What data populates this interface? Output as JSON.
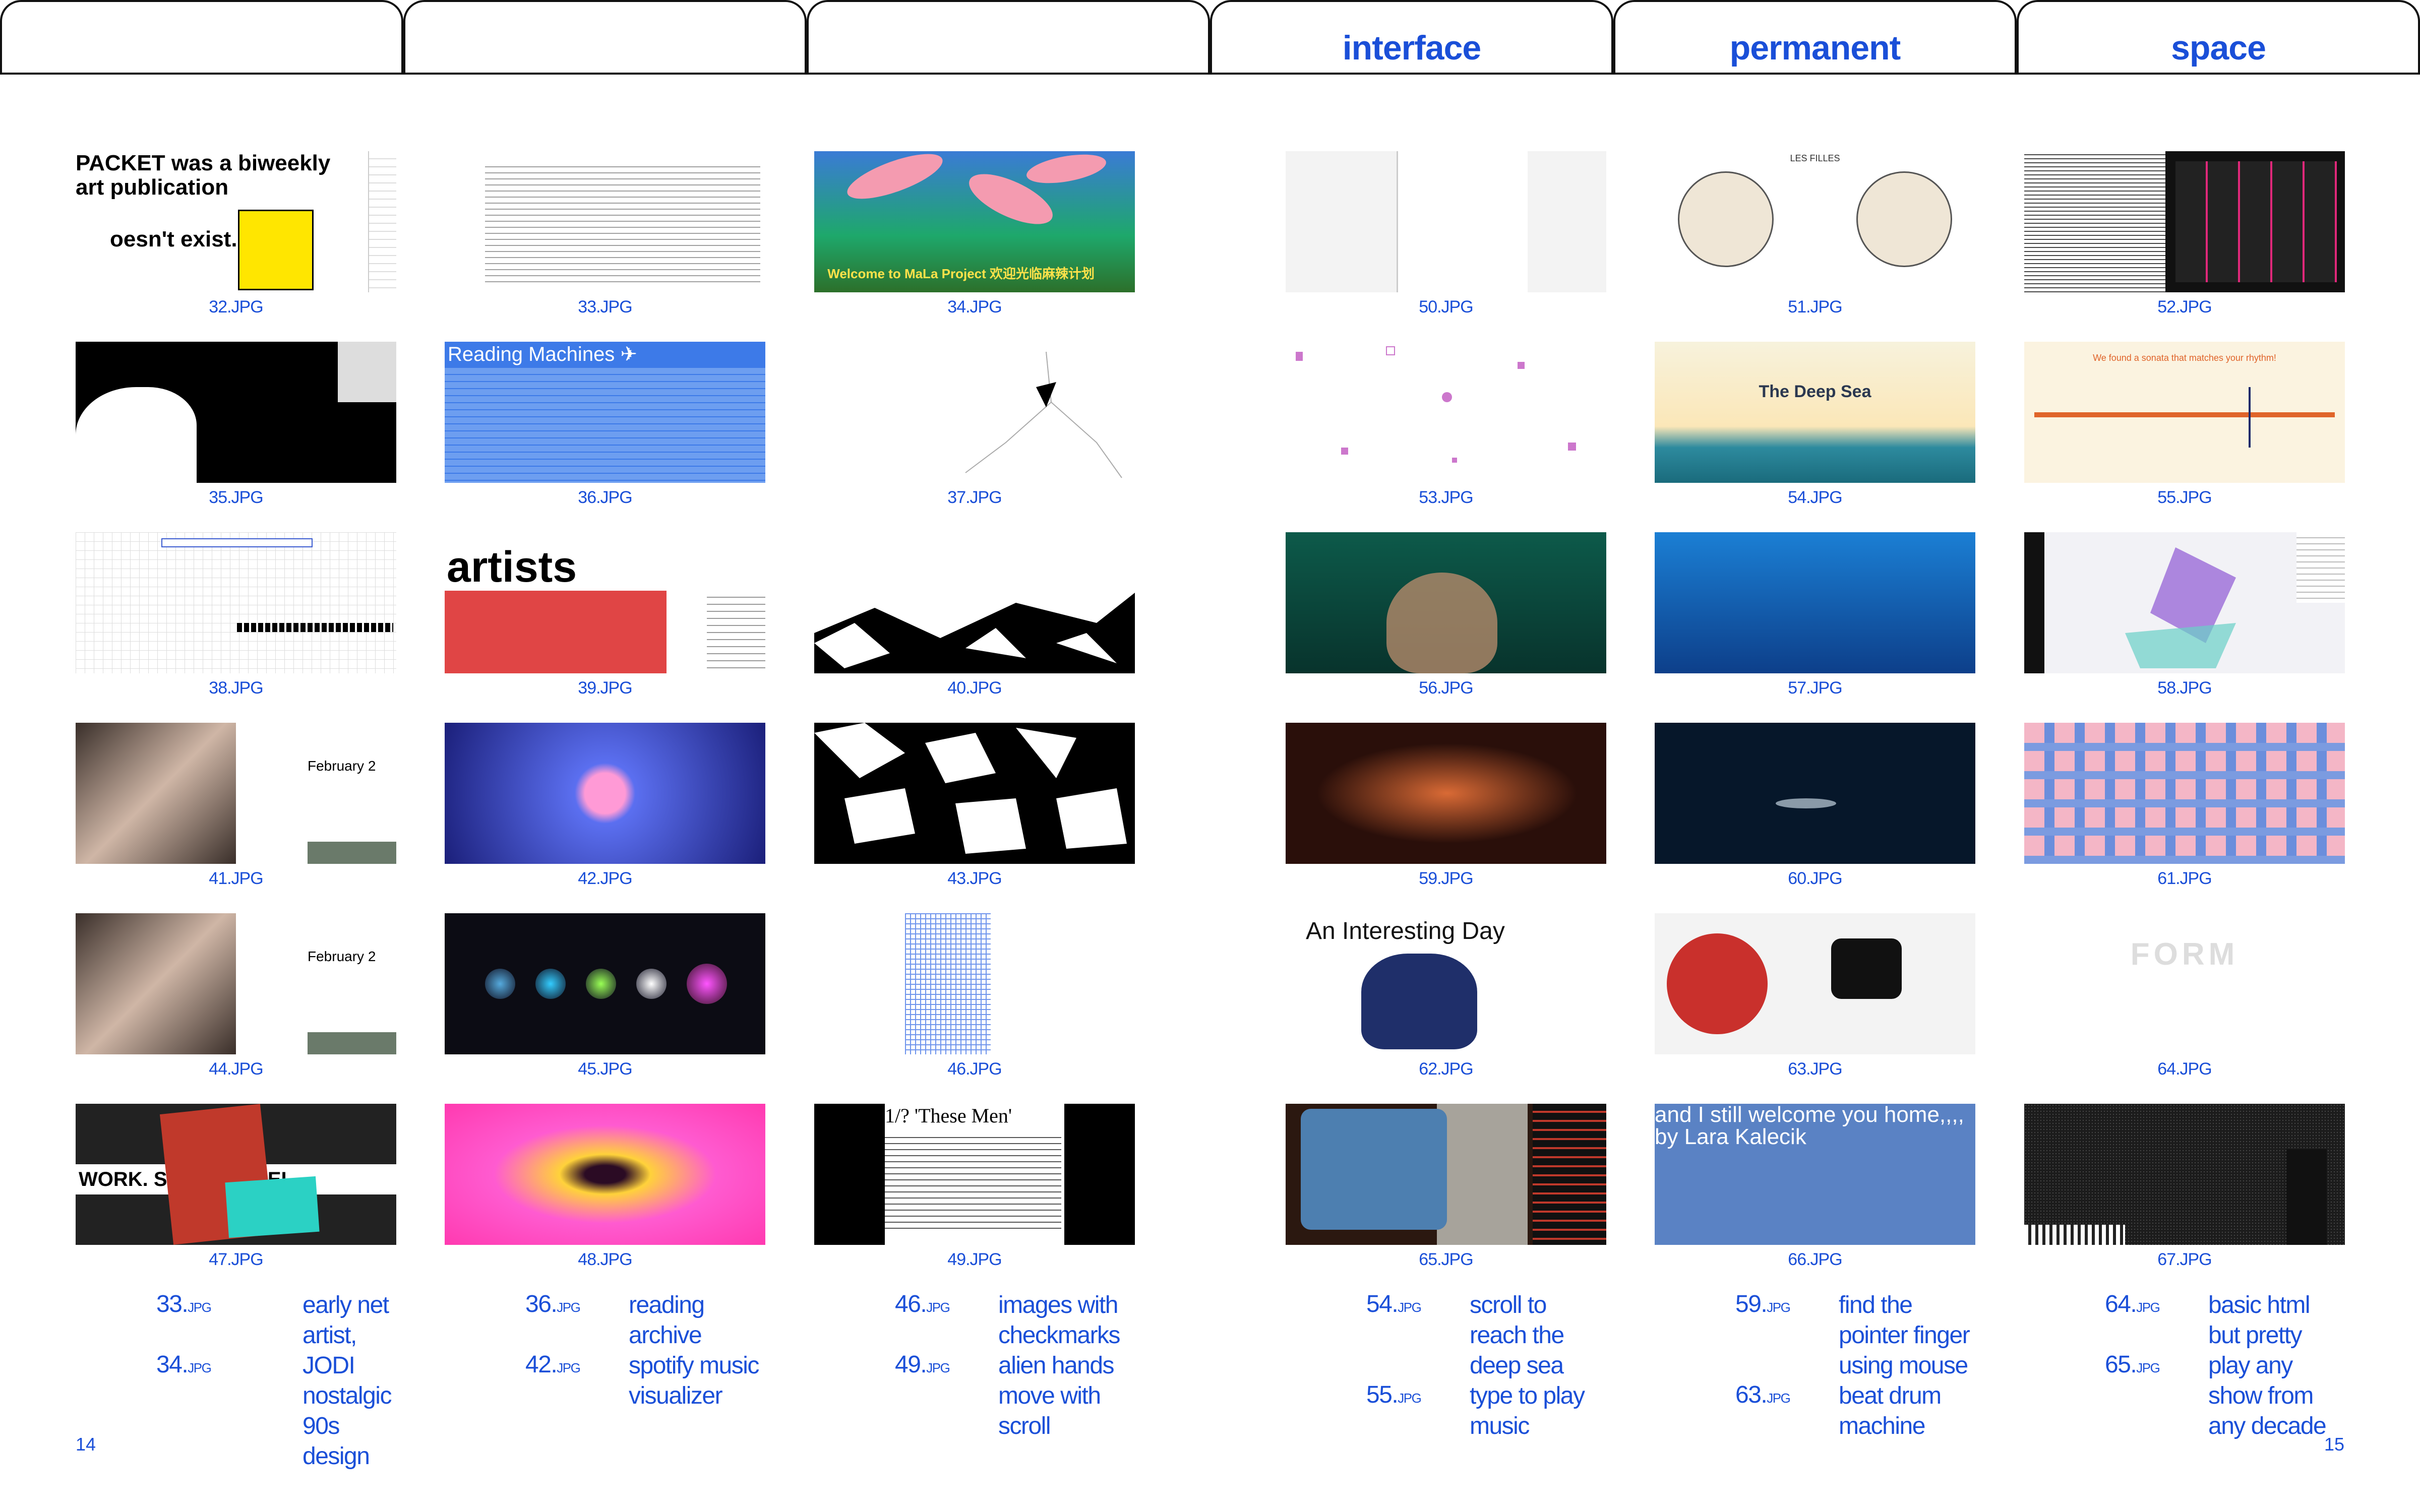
{
  "tabs": [
    {
      "label": ""
    },
    {
      "label": ""
    },
    {
      "label": ""
    },
    {
      "label": "interface"
    },
    {
      "label": "permanent"
    },
    {
      "label": "space"
    }
  ],
  "tiles": {
    "t32": {
      "caption": "32.JPG",
      "headline": "PACKET was a biweekly art publication",
      "snippet": "oesn't exist."
    },
    "t33": {
      "caption": "33.JPG"
    },
    "t34": {
      "caption": "34.JPG",
      "overlay": "Welcome to MaLa Project 欢迎光临麻辣计划"
    },
    "t35": {
      "caption": "35.JPG"
    },
    "t36": {
      "caption": "36.JPG",
      "title": "Reading Machines ✈"
    },
    "t37": {
      "caption": "37.JPG"
    },
    "t38": {
      "caption": "38.JPG"
    },
    "t39": {
      "caption": "39.JPG",
      "title": "artists"
    },
    "t40": {
      "caption": "40.JPG"
    },
    "t41": {
      "caption": "41.JPG",
      "date": "February 2"
    },
    "t42": {
      "caption": "42.JPG"
    },
    "t43": {
      "caption": "43.JPG"
    },
    "t44": {
      "caption": "44.JPG",
      "date": "February 2"
    },
    "t45": {
      "caption": "45.JPG"
    },
    "t46": {
      "caption": "46.JPG"
    },
    "t47": {
      "caption": "47.JPG",
      "word": "WORK. SEL     ORK. SEL"
    },
    "t48": {
      "caption": "48.JPG"
    },
    "t49": {
      "caption": "49.JPG",
      "title": "1/? 'These Men'"
    },
    "t50": {
      "caption": "50.JPG"
    },
    "t51": {
      "caption": "51.JPG",
      "title": "LES FILLES"
    },
    "t52": {
      "caption": "52.JPG"
    },
    "t53": {
      "caption": "53.JPG"
    },
    "t54": {
      "caption": "54.JPG",
      "title": "The Deep Sea"
    },
    "t55": {
      "caption": "55.JPG",
      "title": "We found a sonata that matches your rhythm!"
    },
    "t56": {
      "caption": "56.JPG"
    },
    "t57": {
      "caption": "57.JPG"
    },
    "t58": {
      "caption": "58.JPG"
    },
    "t59": {
      "caption": "59.JPG"
    },
    "t60": {
      "caption": "60.JPG"
    },
    "t61": {
      "caption": "61.JPG"
    },
    "t62": {
      "caption": "62.JPG",
      "title": "An Interesting Day"
    },
    "t63": {
      "caption": "63.JPG"
    },
    "t64": {
      "caption": "64.JPG",
      "title": "FORM"
    },
    "t65": {
      "caption": "65.JPG"
    },
    "t66": {
      "caption": "66.JPG",
      "title": "and I still welcome you home,,,, by Lara Kalecik"
    },
    "t67": {
      "caption": "67.JPG"
    }
  },
  "notes": [
    {
      "refs": [
        {
          "num": "33.",
          "ext": "JPG"
        },
        {
          "num": "34.",
          "ext": "JPG"
        }
      ],
      "lines": [
        "early net",
        "artist, JODI",
        "nostalgic 90s",
        "design"
      ]
    },
    {
      "refs": [
        {
          "num": "36.",
          "ext": "JPG"
        },
        {
          "num": "42.",
          "ext": "JPG"
        }
      ],
      "lines": [
        "reading",
        "archive",
        "spotify music",
        "visualizer"
      ]
    },
    {
      "refs": [
        {
          "num": "46.",
          "ext": "JPG"
        },
        {
          "num": "49.",
          "ext": "JPG"
        }
      ],
      "lines": [
        "images with",
        "checkmarks",
        "alien hands",
        "move with",
        "scroll"
      ]
    },
    {
      "refs": [
        {
          "num": "54.",
          "ext": "JPG"
        },
        {
          "num": "55.",
          "ext": "JPG"
        }
      ],
      "lines": [
        "scroll to",
        "reach the",
        "deep sea",
        "type to play",
        "music"
      ]
    },
    {
      "refs": [
        {
          "num": "59.",
          "ext": "JPG"
        },
        {
          "num": "63.",
          "ext": "JPG"
        }
      ],
      "lines": [
        "find the",
        "pointer finger",
        "using mouse",
        "beat drum",
        "machine"
      ]
    },
    {
      "refs": [
        {
          "num": "64.",
          "ext": "JPG"
        },
        {
          "num": "65.",
          "ext": "JPG"
        }
      ],
      "lines": [
        "basic html",
        "but pretty",
        "play any",
        "show from",
        "any decade"
      ]
    }
  ],
  "page_numbers": {
    "left": "14",
    "right": "15"
  },
  "colors": {
    "accent": "#1a4fd8",
    "line": "#111111"
  }
}
